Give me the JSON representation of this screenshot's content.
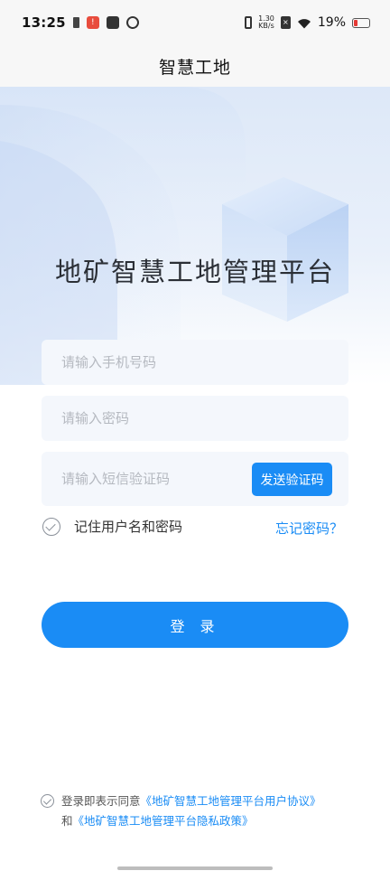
{
  "status_bar": {
    "time": "13:25",
    "net_speed_value": "1.30",
    "net_speed_unit": "KB/s",
    "battery_percent": "19%",
    "icons": [
      "sim-icon",
      "app-notification-icon",
      "message-icon",
      "sync-icon",
      "vibrate-icon",
      "no-sim-icon",
      "wifi-icon",
      "battery-icon"
    ],
    "colors": {
      "battery_low": "#e53935"
    }
  },
  "app_bar": {
    "title": "智慧工地"
  },
  "hero": {
    "platform_title": "地矿智慧工地管理平台"
  },
  "form": {
    "phone_placeholder": "请输入手机号码",
    "password_placeholder": "请输入密码",
    "sms_placeholder": "请输入短信验证码",
    "send_code_label": "发送验证码",
    "remember_label": "记住用户名和密码",
    "forgot_label": "忘记密码？",
    "login_label": "登 录"
  },
  "agreement": {
    "prefix": "登录即表示同意",
    "user_agreement": "《地矿智慧工地管理平台用户协议》",
    "conjunction": "和",
    "privacy_policy": "《地矿智慧工地管理平台隐私政策》"
  },
  "colors": {
    "accent": "#1a8cf5",
    "field_bg": "#f4f7fc",
    "placeholder": "#b5b9c0"
  }
}
